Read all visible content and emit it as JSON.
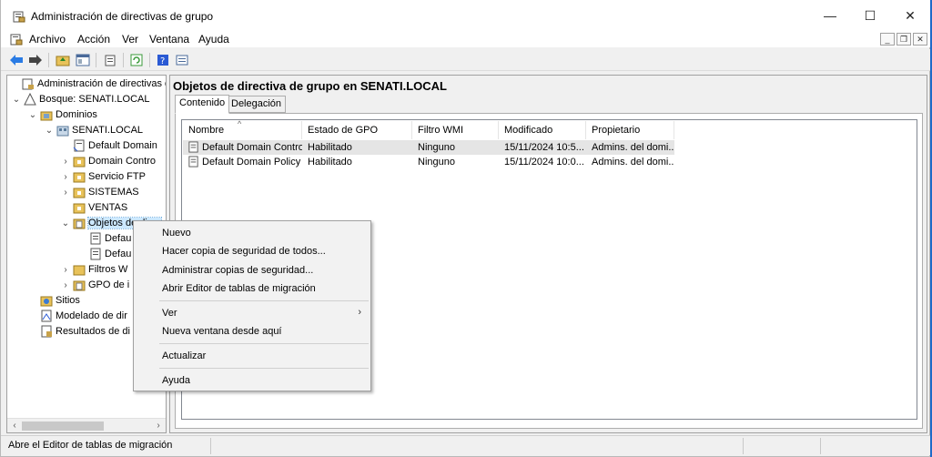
{
  "window": {
    "title": "Administración de directivas de grupo",
    "minimize": "—",
    "maximize": "☐",
    "close": "✕"
  },
  "menubar": {
    "items": [
      "Archivo",
      "Acción",
      "Ver",
      "Ventana",
      "Ayuda"
    ],
    "mdi_minimize": "_",
    "mdi_restore": "❐",
    "mdi_close": "✕"
  },
  "tree": {
    "root": "Administración de directivas d",
    "forest": "Bosque: SENATI.LOCAL",
    "domains": "Dominios",
    "domain": "SENATI.LOCAL",
    "children": [
      "Default Domain",
      "Domain Contro",
      "Servicio FTP",
      "SISTEMAS",
      "VENTAS",
      "Objetos de direc",
      "Defau",
      "Defau",
      "Filtros W",
      "GPO de i"
    ],
    "sites": "Sitios",
    "modeling": "Modelado de dir",
    "results": "Resultados de di"
  },
  "right_pane": {
    "header": "Objetos de directiva de grupo en SENATI.LOCAL",
    "tabs": [
      "Contenido",
      "Delegación"
    ],
    "columns": [
      "Nombre",
      "Estado de GPO",
      "Filtro WMI",
      "Modificado",
      "Propietario"
    ],
    "rows": [
      [
        "Default Domain Contro...",
        "Habilitado",
        "Ninguno",
        "15/11/2024 10:5...",
        "Admins. del domi..."
      ],
      [
        "Default Domain Policy",
        "Habilitado",
        "Ninguno",
        "15/11/2024 10:0...",
        "Admins. del domi..."
      ]
    ]
  },
  "context_menu": {
    "items": [
      "Nuevo",
      "Hacer copia de seguridad de todos...",
      "Administrar copias de seguridad...",
      "Abrir Editor de tablas de migración",
      "Ver",
      "Nueva ventana desde aquí",
      "Actualizar",
      "Ayuda"
    ],
    "submenu_arrow": "›"
  },
  "statusbar": {
    "text": "Abre el Editor de tablas de migración"
  },
  "colors": {
    "selection": "#cce8ff",
    "row_highlight": "#e5e5e5",
    "accent": "#1f6ac8"
  }
}
